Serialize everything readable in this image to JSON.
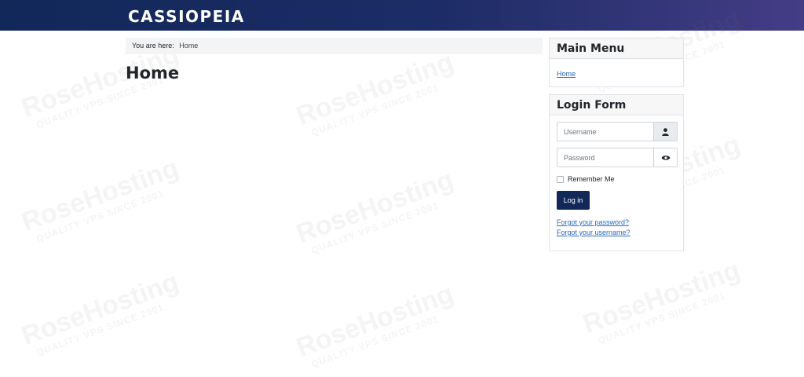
{
  "header": {
    "brand": "CASSIOPEIA"
  },
  "watermark": {
    "main": "RoseHosting",
    "sub": "QUALITY VPS SINCE 2001"
  },
  "breadcrumb": {
    "prefix": "You are here:",
    "current": "Home"
  },
  "page": {
    "title": "Home"
  },
  "main_menu": {
    "title": "Main Menu",
    "items": [
      {
        "label": "Home"
      }
    ]
  },
  "login_form": {
    "title": "Login Form",
    "username_placeholder": "Username",
    "password_placeholder": "Password",
    "remember_label": "Remember Me",
    "login_button": "Log in",
    "forgot_password": "Forgot your password?",
    "forgot_username": "Forgot your username?"
  },
  "icons": {
    "username": "user-icon",
    "password": "eye-icon"
  },
  "colors": {
    "header_start": "#112859",
    "header_end": "#443d86",
    "button": "#112859",
    "link": "#2a69b8"
  }
}
